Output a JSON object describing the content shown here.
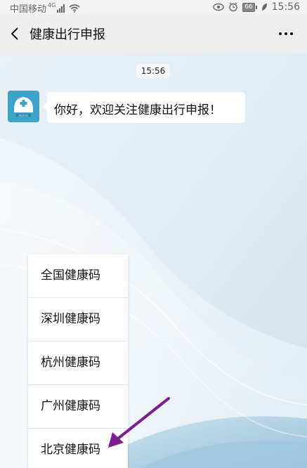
{
  "status_bar": {
    "carrier": "中国移动",
    "network": "4G",
    "battery": "66",
    "time": "15:56"
  },
  "header": {
    "title": "健康出行申报"
  },
  "chat": {
    "timestamp": "15:56",
    "message": "你好，欢迎关注健康出行申报！",
    "avatar_label": "MEDICAL"
  },
  "menu": {
    "items": [
      {
        "label": "全国健康码"
      },
      {
        "label": "深圳健康码"
      },
      {
        "label": "杭州健康码"
      },
      {
        "label": "广州健康码"
      },
      {
        "label": "北京健康码"
      }
    ]
  },
  "colors": {
    "annotation_arrow": "#7a1f8f",
    "avatar_bg": "#3fa3c9"
  }
}
